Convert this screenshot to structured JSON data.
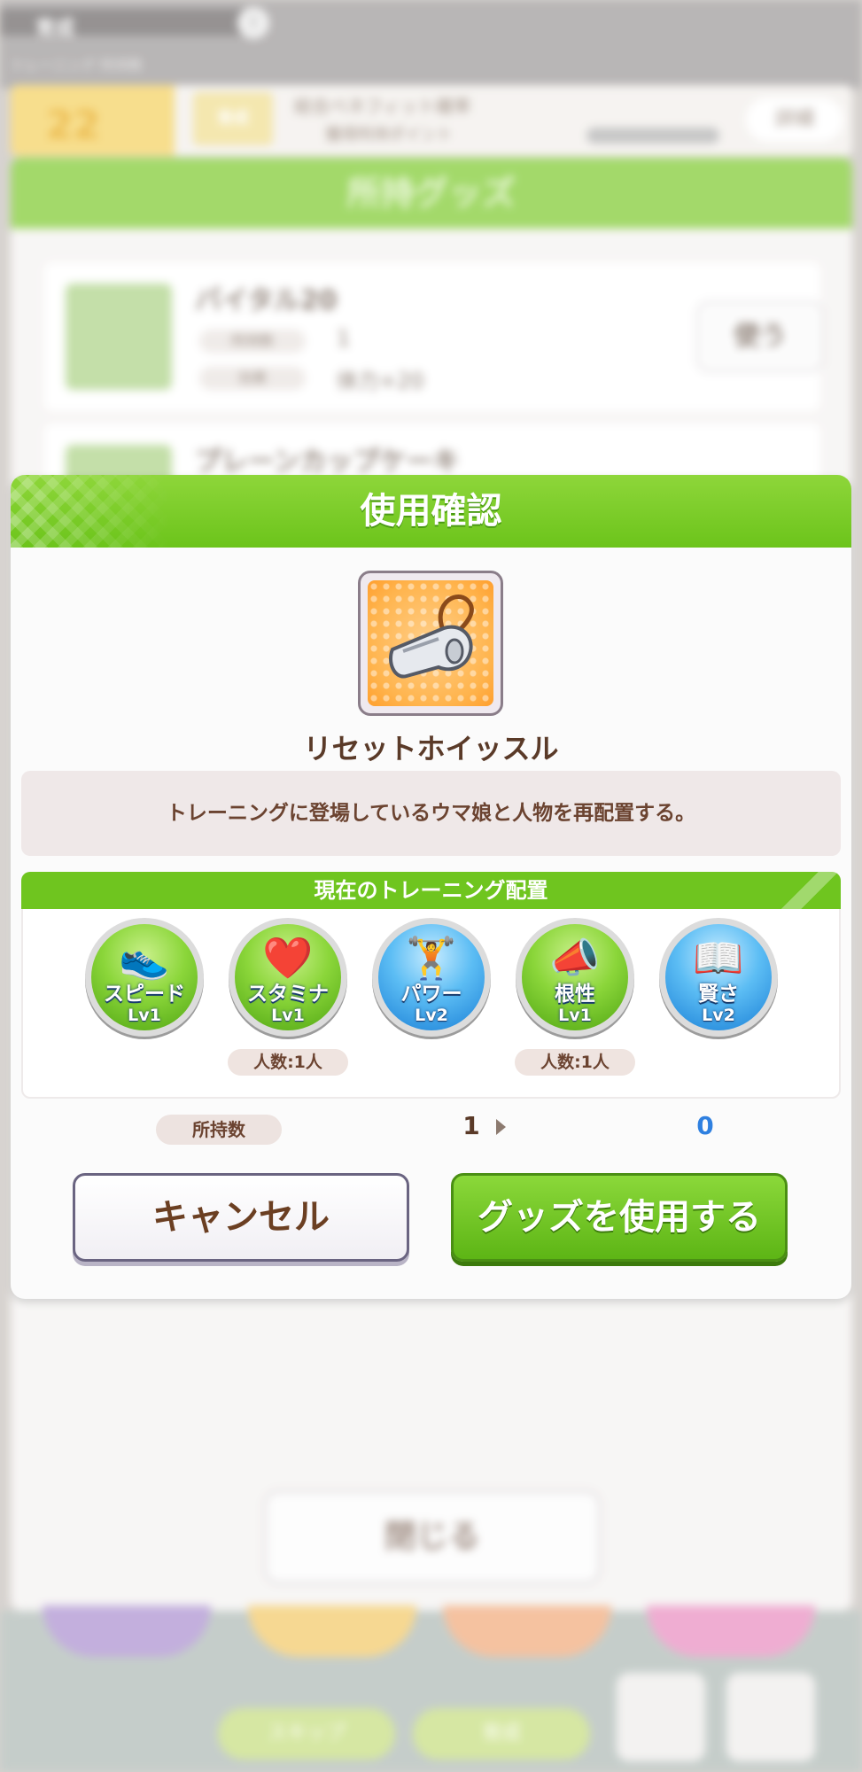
{
  "background": {
    "top_label": "育成",
    "top_sub": "トレーニング 所持数",
    "banner_number": "22",
    "banner_tag": "育成",
    "banner_text_1": "総合ベネフィット確率",
    "banner_text_2": "獲得所持ポイント",
    "banner_button": "詳細",
    "sheet_title": "所持グッズ",
    "items": [
      {
        "name": "バイタル20",
        "row1_label": "所持数",
        "row1_value": "1",
        "row2_label": "効果",
        "row2_value": "体力+20",
        "button": "使う"
      },
      {
        "name": "プレーンカップケーキ"
      }
    ],
    "close_button": "閉じる",
    "pill_1": "スキップ",
    "pill_2": "育成"
  },
  "dialog": {
    "title": "使用確認",
    "item_icon": "whistle-icon",
    "item_name": "リセットホイッスル",
    "description": "トレーニングに登場しているウマ娘と人物を再配置する。",
    "section_title": "現在のトレーニング配置",
    "trainings": [
      {
        "label": "スピード",
        "level": "Lv1",
        "icon": "shoes-icon",
        "color": "green"
      },
      {
        "label": "スタミナ",
        "level": "Lv1",
        "icon": "heart-icon",
        "color": "green",
        "people": "人数:1人"
      },
      {
        "label": "パワー",
        "level": "Lv2",
        "icon": "dumbbell-icon",
        "color": "blue"
      },
      {
        "label": "根性",
        "level": "Lv1",
        "icon": "megaphone-icon",
        "color": "green",
        "people": "人数:1人"
      },
      {
        "label": "賢さ",
        "level": "Lv2",
        "icon": "book-icon",
        "color": "blue"
      }
    ],
    "owned_label": "所持数",
    "owned_before": "1",
    "owned_after": "0",
    "cancel_button": "キャンセル",
    "use_button": "グッズを使用する"
  },
  "colors": {
    "accent_green": "#6cc41b",
    "text_brown": "#6b4330",
    "after_blue": "#2f80e0"
  }
}
